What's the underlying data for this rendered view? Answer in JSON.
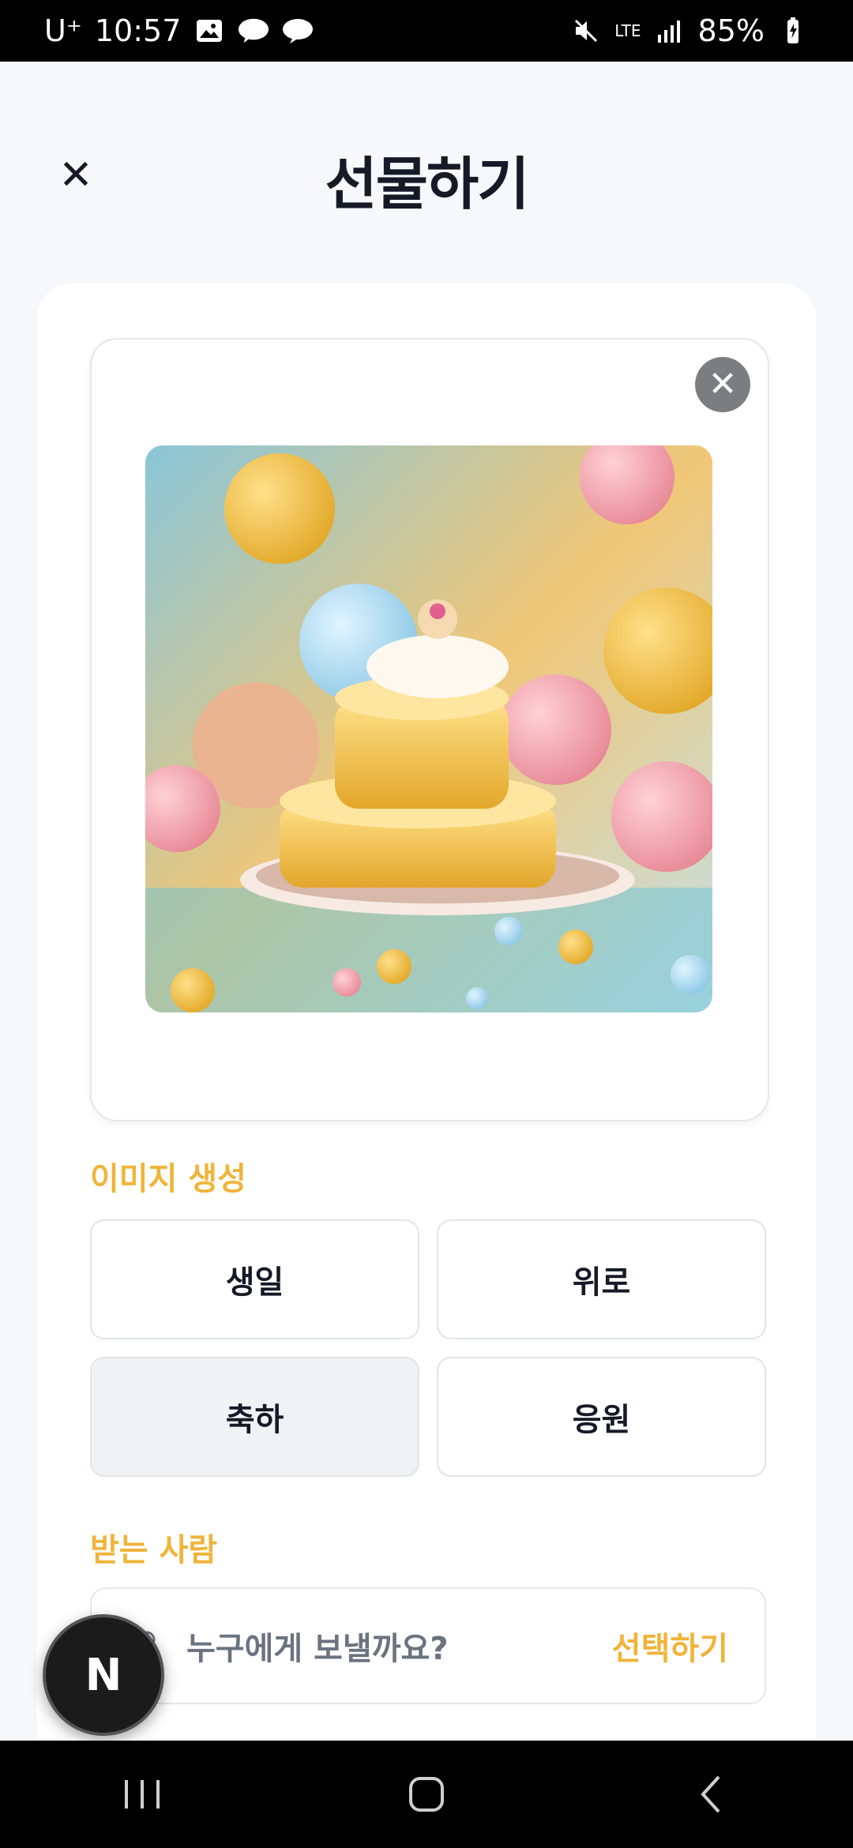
{
  "status": {
    "carrier": "U⁺",
    "time": "10:57",
    "battery": "85%",
    "network": "LTE",
    "talk": "TALK",
    "icons": [
      "gallery-icon",
      "talk-icon",
      "chat-icon",
      "mute-icon",
      "signal-icon",
      "battery-icon"
    ]
  },
  "header": {
    "title": "선물하기",
    "close_icon": "close-icon"
  },
  "image_card": {
    "remove_icon": "close-circle-icon",
    "image_alt": "birthday cake illustration"
  },
  "image_generation": {
    "label": "이미지 생성",
    "options": [
      "생일",
      "위로",
      "축하",
      "응원"
    ],
    "selected": "축하"
  },
  "recipient": {
    "label": "받는 사람",
    "placeholder": "누구에게 보낼까요?",
    "action": "선택하기",
    "icon": "person-icon"
  },
  "fab": {
    "letter": "N"
  },
  "colors": {
    "accent": "#f0b43a",
    "background": "#f7f8fb",
    "text": "#151a26"
  }
}
